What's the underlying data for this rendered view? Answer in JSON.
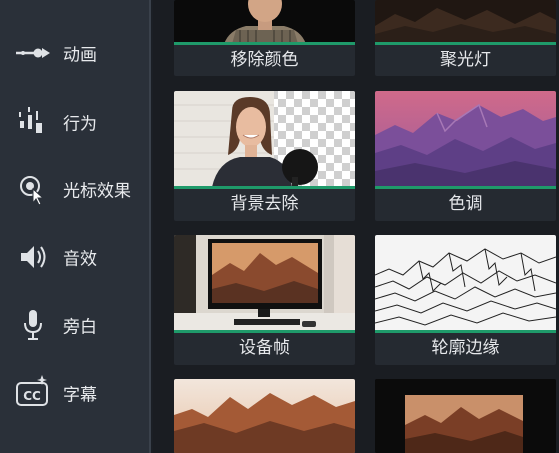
{
  "sidebar": {
    "items": [
      {
        "label": "动画",
        "icon": "animation-arrow-icon"
      },
      {
        "label": "行为",
        "icon": "behavior-bars-icon"
      },
      {
        "label": "光标效果",
        "icon": "cursor-effect-icon"
      },
      {
        "label": "音效",
        "icon": "speaker-icon"
      },
      {
        "label": "旁白",
        "icon": "microphone-icon"
      },
      {
        "label": "字幕",
        "icon": "captions-cc-icon"
      }
    ]
  },
  "effects": {
    "row1": [
      {
        "label": "移除颜色"
      },
      {
        "label": "聚光灯"
      }
    ],
    "row2": [
      {
        "label": "背景去除"
      },
      {
        "label": "色调"
      }
    ],
    "row3": [
      {
        "label": "设备帧"
      },
      {
        "label": "轮廓边缘"
      }
    ]
  },
  "colors": {
    "accent_line": "#1f9a6a",
    "sidebar_bg": "#2a3039",
    "main_bg": "#1a1d22"
  }
}
